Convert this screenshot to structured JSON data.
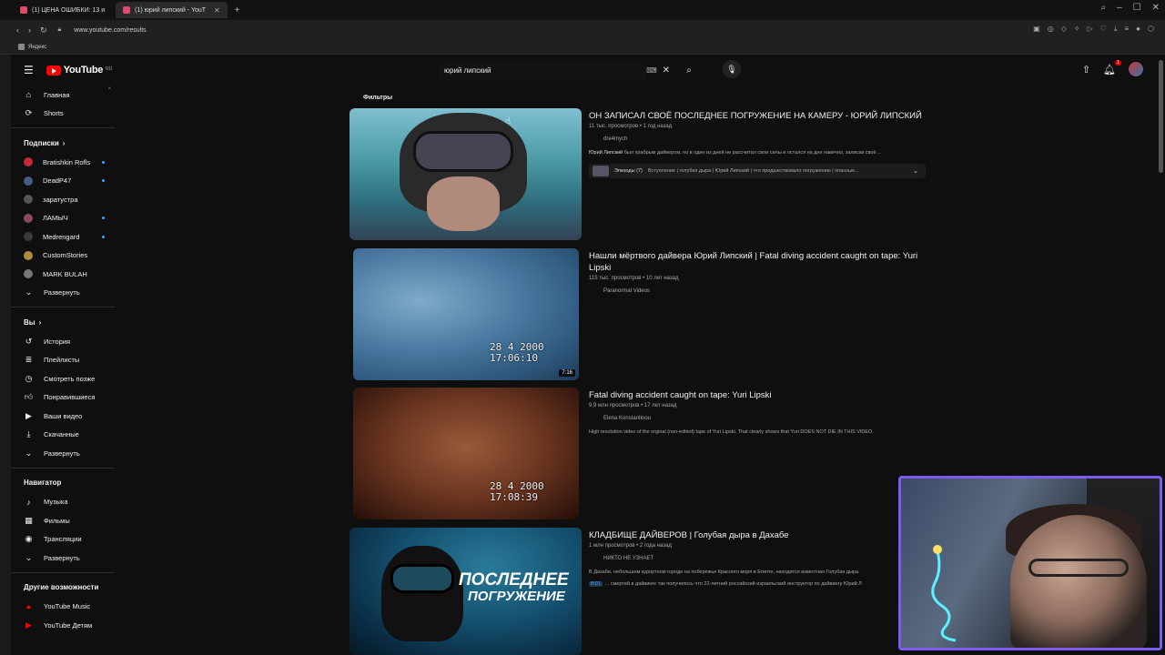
{
  "browser": {
    "tabs": [
      {
        "label": "(1) ЦЕНА ОШИБКИ: 13 и",
        "active": false
      },
      {
        "label": "(1) юрий липский - YouT",
        "active": true
      }
    ],
    "url": "www.youtube.com/results",
    "bookmark": "Яндекс"
  },
  "masthead": {
    "logo_text": "YouTube",
    "logo_region": "RU",
    "search_value": "юрий липский",
    "notification_count": "1"
  },
  "sidebar": {
    "main": [
      {
        "label": "Главная",
        "icon": "home-icon"
      },
      {
        "label": "Shorts",
        "icon": "shorts-icon"
      }
    ],
    "subscriptions_title": "Подписки",
    "subscriptions": [
      {
        "label": "Bratishkin Rofls",
        "color": "#c8283c",
        "dot": true
      },
      {
        "label": "DeadP47",
        "color": "#4a5a8a",
        "dot": true
      },
      {
        "label": "заратустра",
        "color": "#555555",
        "dot": false
      },
      {
        "label": "ЛАМЫЧ",
        "color": "#8a4a5a",
        "dot": true
      },
      {
        "label": "Medrengard",
        "color": "#3a3a3a",
        "dot": true
      },
      {
        "label": "CustomStories",
        "color": "#b08a3a",
        "dot": false
      },
      {
        "label": "MARK BULAH",
        "color": "#777777",
        "dot": false
      }
    ],
    "subs_expand": "Развернуть",
    "you_title": "Вы",
    "you": [
      {
        "label": "История",
        "icon": "history-icon"
      },
      {
        "label": "Плейлисты",
        "icon": "playlists-icon"
      },
      {
        "label": "Смотреть позже",
        "icon": "watch-later-icon"
      },
      {
        "label": "Понравившиеся",
        "icon": "like-icon"
      },
      {
        "label": "Ваши видео",
        "icon": "your-videos-icon"
      },
      {
        "label": "Скачанные",
        "icon": "download-icon"
      }
    ],
    "you_expand": "Развернуть",
    "nav_title": "Навигатор",
    "nav": [
      {
        "label": "Музыка",
        "icon": "music-icon"
      },
      {
        "label": "Фильмы",
        "icon": "movies-icon"
      },
      {
        "label": "Трансляции",
        "icon": "live-icon"
      }
    ],
    "nav_expand": "Развернуть",
    "more_title": "Другие возможности",
    "more": [
      {
        "label": "YouTube Music",
        "icon": "youtube-music-icon"
      },
      {
        "label": "YouTube Детям",
        "icon": "youtube-kids-icon"
      }
    ]
  },
  "filters_label": "Фильтры",
  "results": [
    {
      "title": "ОН ЗАПИСАЛ СВОЁ ПОСЛЕДНЕЕ ПОГРУЖЕНИЕ НА КАМЕРУ - ЮРИЙ ЛИПСКИЙ",
      "meta": "11 тыс. просмотров • 1 год назад",
      "channel": "dre4mych",
      "desc_bold": "Юрий Липский",
      "desc": " был храбрым дайвером, но в один из дней не рассчитал свои силы и остался на дне навечно, записав своё ...",
      "chapters_label": "Эпизоды (7)",
      "chapters_text": "Вступление | голубая дыра | Юрий Липский | что предшествовало погружению | опасные...",
      "thumb_date": "",
      "duration": ""
    },
    {
      "title": "Нашли мёртвого дайвера Юрий Липский | Fatal diving accident caught on tape: Yuri Lipski",
      "meta": "115 тыс. просмотров • 10 лет назад",
      "channel": "Paranormal Videos",
      "thumb_date": "28  4 2000",
      "thumb_time": "17:06:10",
      "duration": "7:16"
    },
    {
      "title": "Fatal diving accident caught on tape: Yuri Lipski",
      "meta": "9,9 млн просмотров • 17 лет назад",
      "channel": "Elena Konstantinou",
      "desc": "High resolution video of the orginal (non-edited) tape of Yuri Lipski. That clearly shows that Yuri DOES NOT DIE IN THIS VIDEO.",
      "thumb_date": "28  4 2000",
      "thumb_time": "17:08:39"
    },
    {
      "title": "КЛАДБИЩЕ ДАЙВЕРОВ | Голубая дыра в Дахабе",
      "meta": "1 млн просмотров • 2 года назад",
      "channel": "НИКТО НЕ УЗНАЕТ",
      "desc": "В Дахабе, небольшом курортном городе на побережье Красного моря в Египте, находится известная Голубая дыра.",
      "ts": "8:01",
      "ts_text": "... смертей в дайвинге так получилось что 22-летний российский израильский инструктор по дайвингу Юрий Л",
      "thumb_caption_1": "ПОСЛЕДНЕЕ",
      "thumb_caption_2": "ПОГРУЖЕНИЕ"
    }
  ]
}
